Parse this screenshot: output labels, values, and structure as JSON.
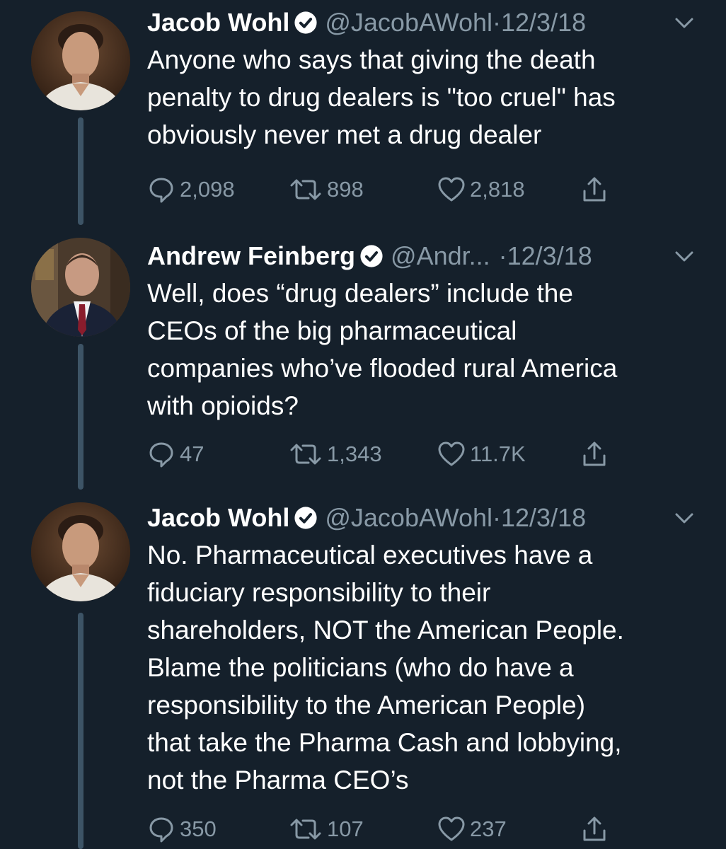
{
  "thread": {
    "tweets": [
      {
        "author": {
          "name": "Jacob Wohl",
          "handle": "@JacobAWohl",
          "verified": true,
          "avatar_icon": "profile-photo-jacob-wohl"
        },
        "separator": "·",
        "date": "12/3/18",
        "text": "Anyone who says that giving the death\npenalty to drug dealers is \"too cruel\" has\nobviously never met a drug dealer",
        "replies": "2,098",
        "retweets": "898",
        "likes": "2,818"
      },
      {
        "author": {
          "name": "Andrew Feinberg",
          "handle": "@Andr...",
          "verified": true,
          "avatar_icon": "profile-photo-andrew-feinberg"
        },
        "separator": "·",
        "date": "12/3/18",
        "text": "Well, does “drug dealers” include the\nCEOs of the big pharmaceutical\ncompanies who’ve flooded rural America\nwith opioids?",
        "replies": "47",
        "retweets": "1,343",
        "likes": "11.7K"
      },
      {
        "author": {
          "name": "Jacob Wohl",
          "handle": "@JacobAWohl",
          "verified": true,
          "avatar_icon": "profile-photo-jacob-wohl"
        },
        "separator": "·",
        "date": "12/3/18",
        "text": "No. Pharmaceutical executives have a\nfiduciary responsibility to their\nshareholders, NOT the American People.\nBlame the politicians (who do have a\nresponsibility to the American People)\nthat take the Pharma Cash and lobbying,\nnot the Pharma CEO’s",
        "replies": "350",
        "retweets": "107",
        "likes": "237"
      }
    ]
  },
  "icons": {
    "reply": "reply-icon",
    "retweet": "retweet-icon",
    "like": "like-icon",
    "share": "share-icon",
    "verified": "verified-badge-icon",
    "menu": "chevron-down-icon"
  },
  "colors": {
    "background": "#15202b",
    "primary_text": "#ffffff",
    "secondary_text": "#8899a6",
    "thread_line": "#3d5466"
  }
}
